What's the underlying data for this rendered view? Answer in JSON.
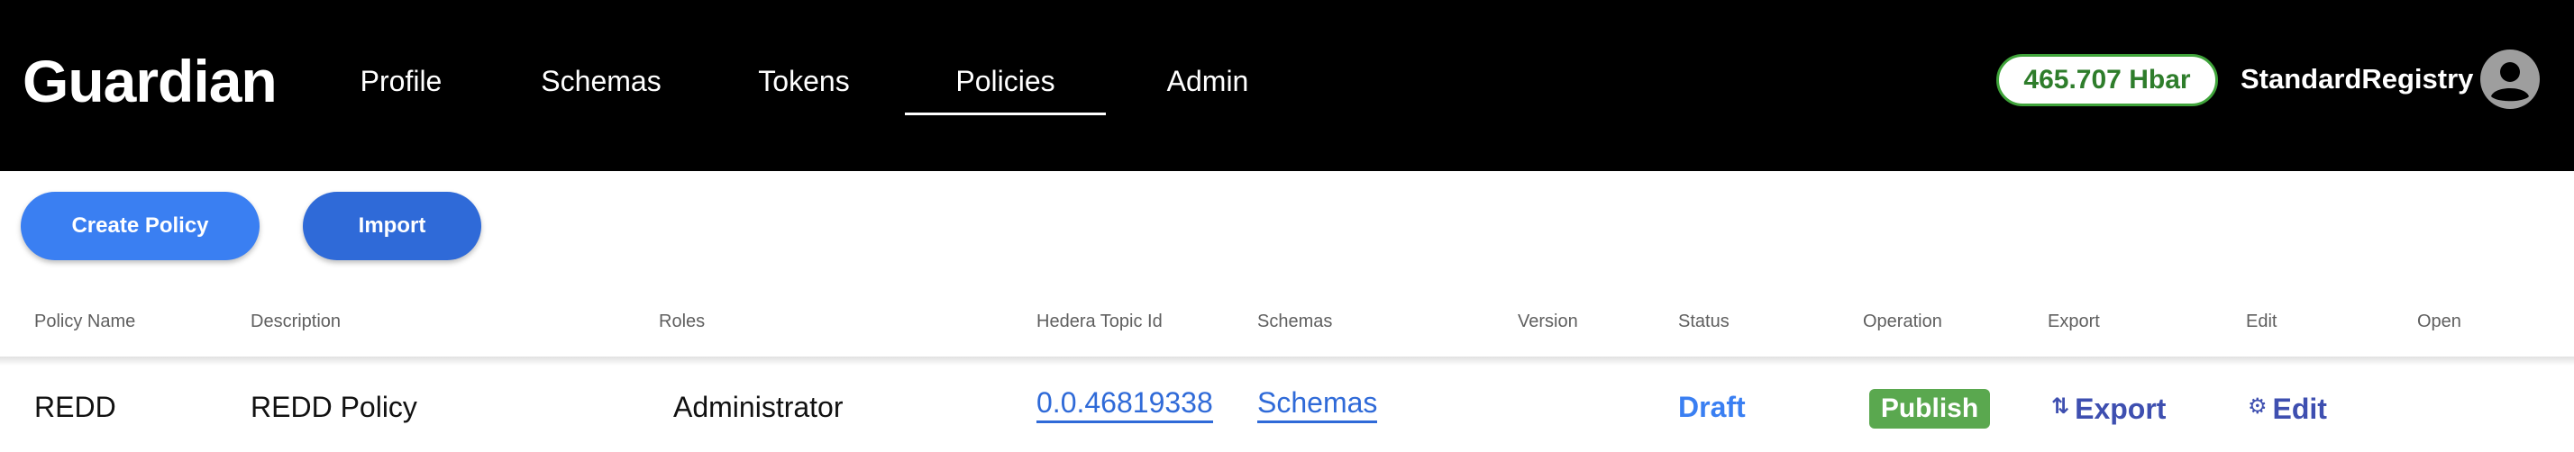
{
  "app": {
    "brand": "Guardian"
  },
  "nav": {
    "items": [
      {
        "label": "Profile"
      },
      {
        "label": "Schemas"
      },
      {
        "label": "Tokens"
      },
      {
        "label": "Policies",
        "active": true
      },
      {
        "label": "Admin"
      }
    ]
  },
  "account": {
    "balance": "465.707 Hbar",
    "username": "StandardRegistry",
    "avatar_icon": "account-circle-icon"
  },
  "toolbar": {
    "create_label": "Create Policy",
    "import_label": "Import"
  },
  "table": {
    "columns": [
      "Policy Name",
      "Description",
      "Roles",
      "Hedera Topic Id",
      "Schemas",
      "Version",
      "Status",
      "Operation",
      "Export",
      "Edit",
      "Open"
    ],
    "rows": [
      {
        "policy_name": "REDD",
        "description": "REDD Policy",
        "roles": "Administrator",
        "topic_id": "0.0.46819338",
        "schemas": "Schemas",
        "version": "",
        "status": "Draft",
        "operation": "Publish",
        "export": "Export",
        "export_icon": "swap-vert-icon",
        "edit": "Edit",
        "edit_icon": "gear-icon",
        "open": ""
      }
    ]
  },
  "colors": {
    "topbar": "#000000",
    "primary": "#3a7ff2",
    "balance_border": "#3fa33a",
    "publish": "#5aa84f",
    "action": "#3e4fb0"
  }
}
